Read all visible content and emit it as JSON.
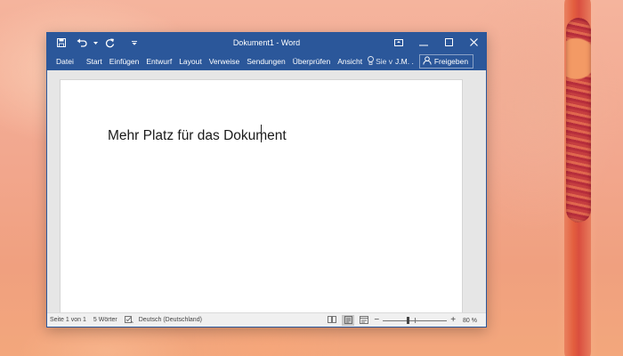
{
  "window": {
    "title": "Dokument1 - Word",
    "accent_color": "#2b579a"
  },
  "quick_access": [
    {
      "name": "save-icon"
    },
    {
      "name": "undo-icon"
    },
    {
      "name": "redo-icon"
    },
    {
      "name": "customize-dropdown-icon"
    }
  ],
  "ribbon": {
    "file_tab": "Datei",
    "tabs": [
      "Start",
      "Einfügen",
      "Entwurf",
      "Layout",
      "Verweise",
      "Sendungen",
      "Überprüfen",
      "Ansicht"
    ],
    "tell_me": "Sie v",
    "user": "J.M. .",
    "share": "Freigeben"
  },
  "document": {
    "text": "Mehr Platz für das Dokument"
  },
  "status_bar": {
    "page": "Seite 1 von 1",
    "words": "5 Wörter",
    "language": "Deutsch (Deutschland)",
    "zoom_minus": "−",
    "zoom_plus": "+",
    "zoom_label": "80 %",
    "zoom_fraction": 0.4
  }
}
